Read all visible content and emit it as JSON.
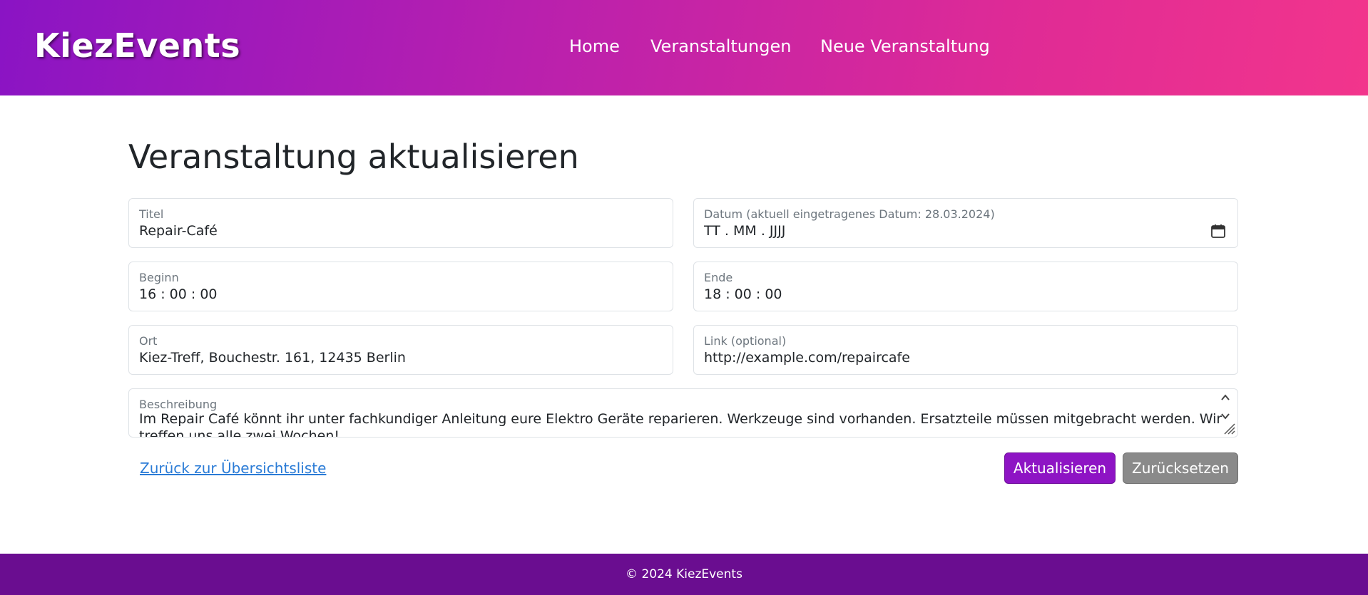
{
  "header": {
    "brand": "KiezEvents",
    "nav": [
      {
        "label": "Home"
      },
      {
        "label": "Veranstaltungen"
      },
      {
        "label": "Neue Veranstaltung"
      }
    ],
    "gradient_colors": [
      "#8a14c4",
      "#f2358c"
    ]
  },
  "main": {
    "title": "Veranstaltung aktualisieren",
    "fields": {
      "titel": {
        "label": "Titel",
        "value": "Repair-Café"
      },
      "datum": {
        "label": "Datum (aktuell eingetragenes Datum: 28.03.2024)",
        "value": "TT . MM . JJJJ",
        "icon": "calendar-icon"
      },
      "beginn": {
        "label": "Beginn",
        "value": "16 : 00 : 00"
      },
      "ende": {
        "label": "Ende",
        "value": "18 : 00 : 00"
      },
      "ort": {
        "label": "Ort",
        "value": "Kiez-Treff, Bouchestr. 161, 12435 Berlin"
      },
      "link": {
        "label": "Link (optional)",
        "value": "http://example.com/repaircafe"
      },
      "beschreibung": {
        "label": "Beschreibung",
        "value": "Im Repair Café könnt ihr unter fachkundiger Anleitung eure Elektro Geräte reparieren. Werkzeuge sind vorhanden. Ersatzteile müssen mitgebracht werden. Wir treffen uns alle zwei Wochen!"
      }
    },
    "back_link": "Zurück zur Übersichtsliste",
    "buttons": {
      "update": "Aktualisieren",
      "reset": "Zurücksetzen"
    },
    "accent_color": "#8e14c4",
    "link_color": "#2a7bd6"
  },
  "footer": {
    "text": "© 2024 KiezEvents",
    "color": "#6a0d90"
  }
}
